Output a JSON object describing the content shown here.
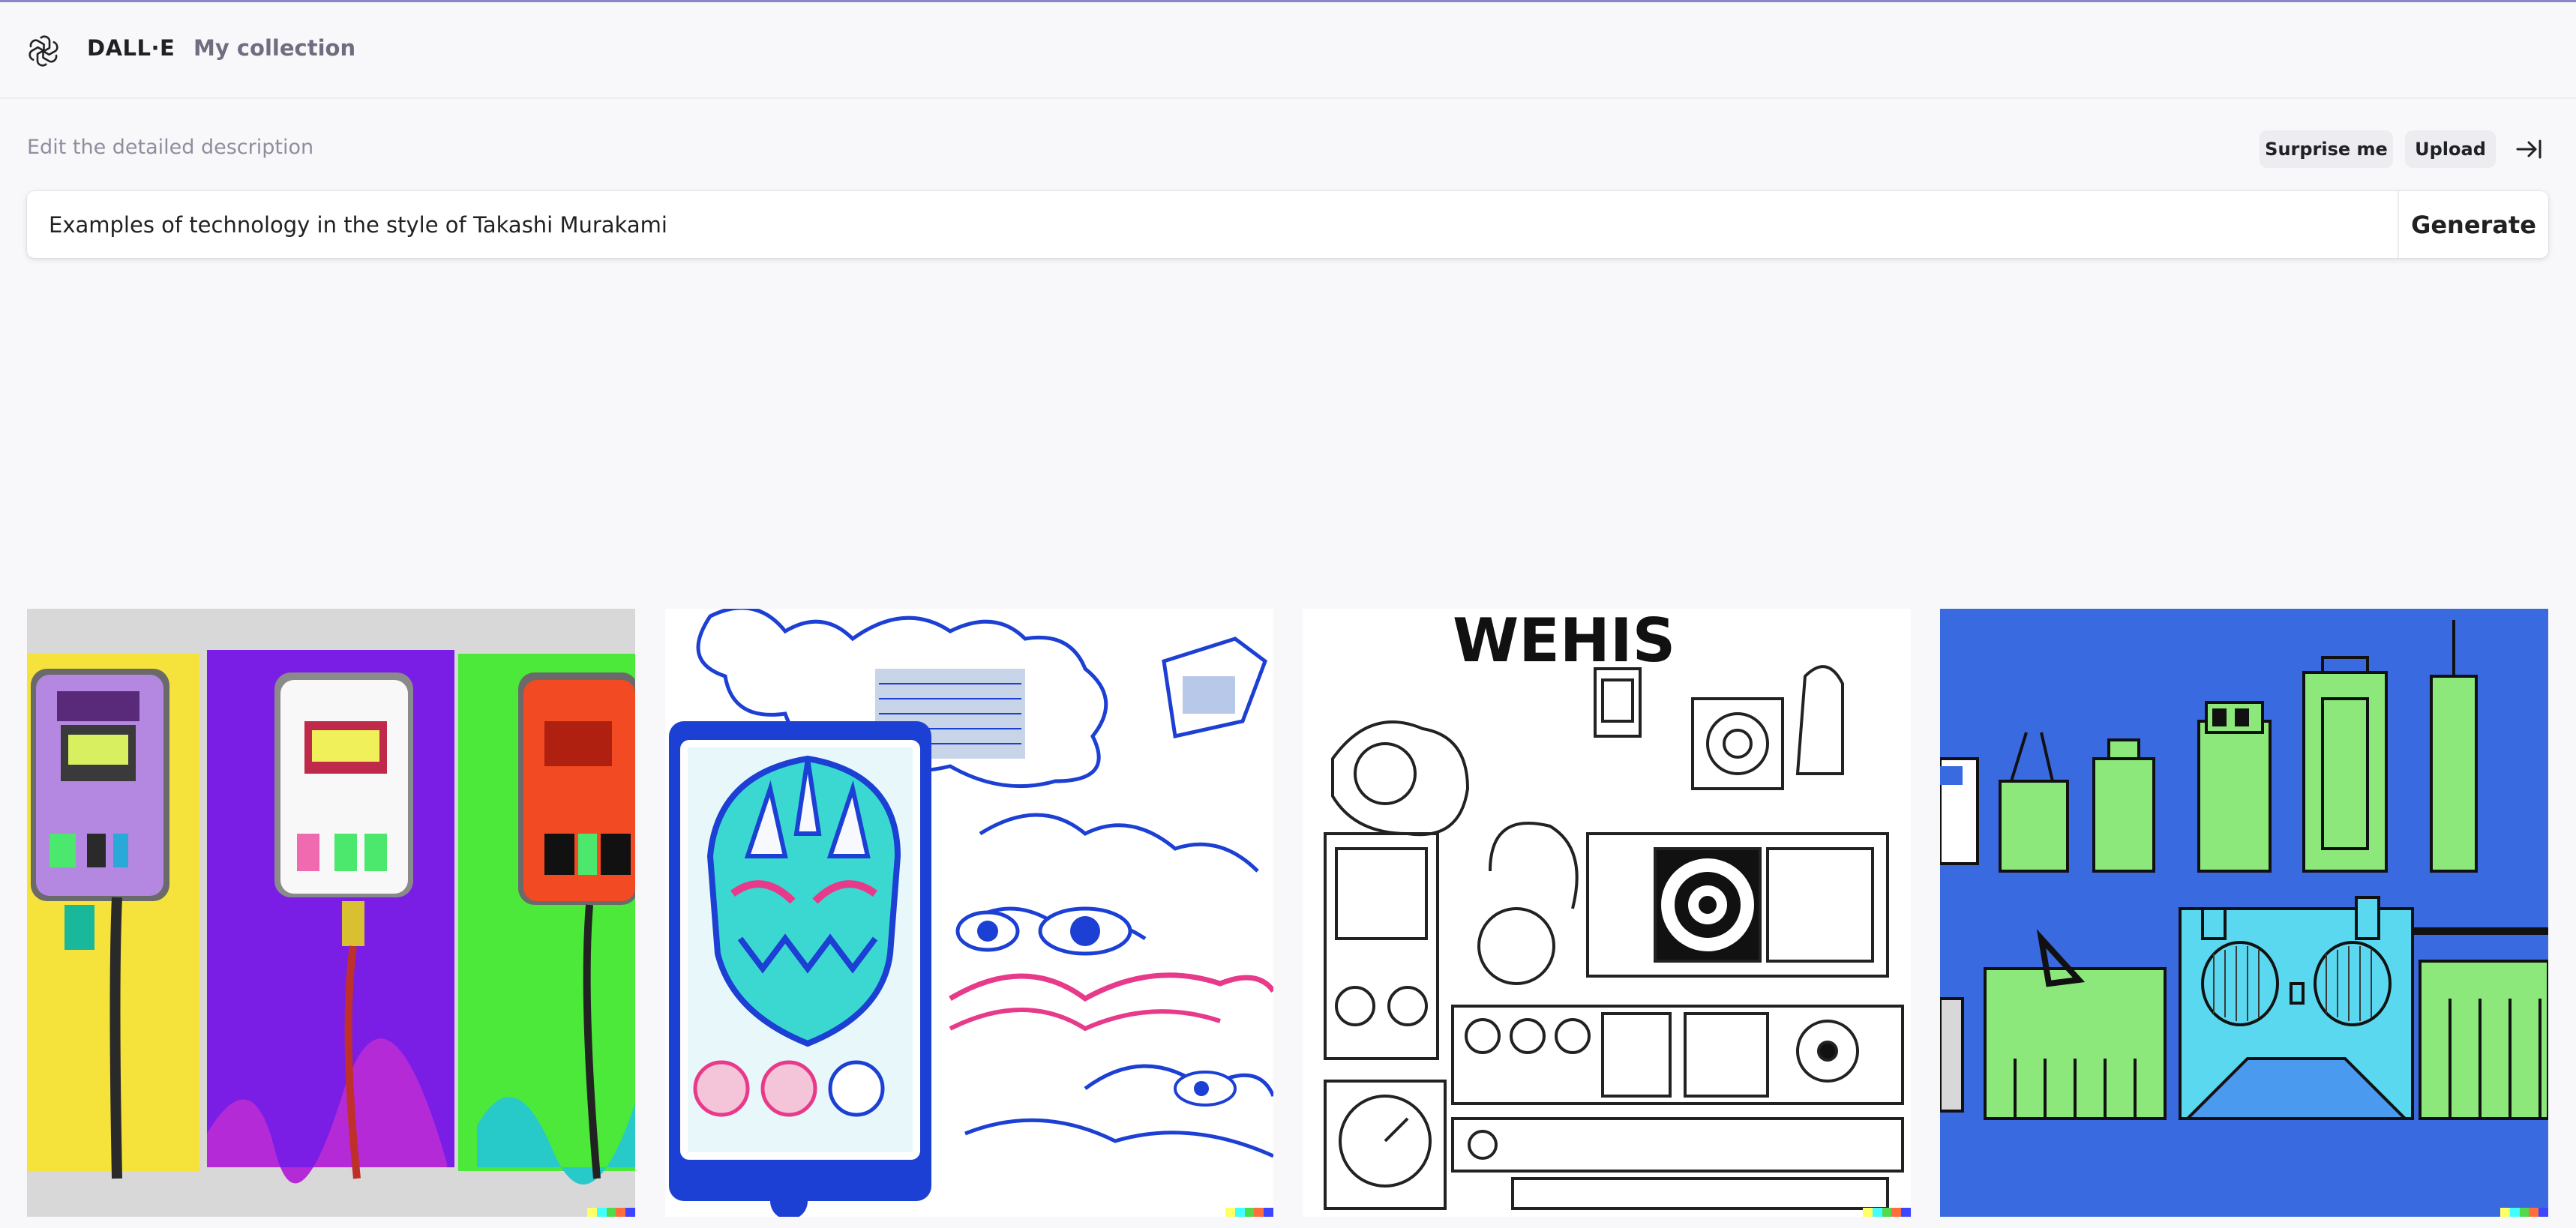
{
  "header": {
    "brand": "DALL·E",
    "collection_link": "My collection",
    "logo_icon": "openai-logo-icon"
  },
  "editor": {
    "description_label": "Edit the detailed description",
    "surprise_label": "Surprise me",
    "upload_label": "Upload",
    "collapse_icon": "collapse-right-icon",
    "prompt_value": "Examples of technology in the style of Takashi Murakami",
    "generate_label": "Generate"
  },
  "results": {
    "images": [
      {
        "index": 1,
        "headline": ""
      },
      {
        "index": 2,
        "headline": ""
      },
      {
        "index": 3,
        "headline": "WEHIS"
      },
      {
        "index": 4,
        "headline": ""
      }
    ],
    "signature_colors": [
      "#ffff66",
      "#42ffff",
      "#51da4c",
      "#ff6e3c",
      "#3c46ff"
    ]
  },
  "colors": {
    "accent_bar": "#8b87c7",
    "page_bg": "#f8f8fa",
    "pill_bg": "#ececf1"
  }
}
